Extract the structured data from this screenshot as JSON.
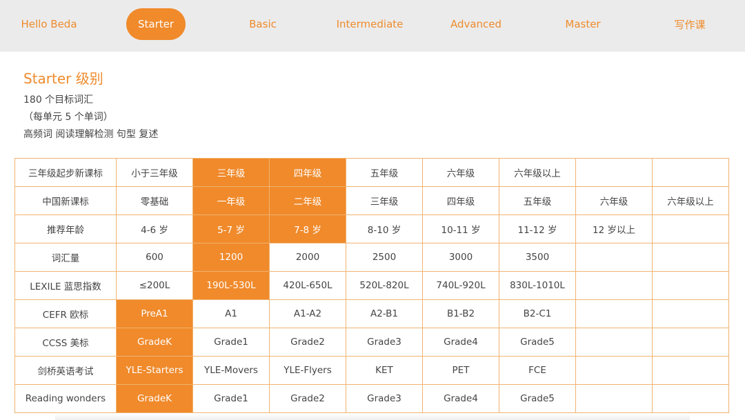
{
  "nav": {
    "items": [
      {
        "label": "Hello Beda"
      },
      {
        "label": "Starter"
      },
      {
        "label": "Basic"
      },
      {
        "label": "Intermediate"
      },
      {
        "label": "Advanced"
      },
      {
        "label": "Master"
      },
      {
        "label": "写作课"
      }
    ],
    "active_index": 1
  },
  "intro": {
    "title": "Starter 级别",
    "lines": [
      "180 个目标词汇",
      "（每单元 5 个单词）",
      "高频词 阅读理解检测 句型 复述"
    ]
  },
  "table": {
    "rows": [
      {
        "cells": [
          "三年级起步新课标",
          "小于三年级",
          "三年级",
          "四年级",
          "五年级",
          "六年级",
          "六年级以上",
          "",
          ""
        ],
        "highlight": [
          2,
          3
        ]
      },
      {
        "cells": [
          "中国新课标",
          "零基础",
          "一年级",
          "二年级",
          "三年级",
          "四年级",
          "五年级",
          "六年级",
          "六年级以上"
        ],
        "highlight": [
          2,
          3
        ]
      },
      {
        "cells": [
          "推荐年龄",
          "4-6 岁",
          "5-7 岁",
          "7-8 岁",
          "8-10 岁",
          "10-11 岁",
          "11-12 岁",
          "12 岁以上",
          ""
        ],
        "highlight": [
          2,
          3
        ]
      },
      {
        "cells": [
          "词汇量",
          "600",
          "1200",
          "2000",
          "2500",
          "3000",
          "3500",
          "",
          ""
        ],
        "highlight": [
          2
        ]
      },
      {
        "cells": [
          "LEXILE 蓝思指数",
          "≤200L",
          "190L-530L",
          "420L-650L",
          "520L-820L",
          "740L-920L",
          "830L-1010L",
          "",
          ""
        ],
        "highlight": [
          2
        ]
      },
      {
        "cells": [
          "CEFR 欧标",
          "PreA1",
          "A1",
          "A1-A2",
          "A2-B1",
          "B1-B2",
          "B2-C1",
          "",
          ""
        ],
        "highlight": [
          1
        ]
      },
      {
        "cells": [
          "CCSS 美标",
          "GradeK",
          "Grade1",
          "Grade2",
          "Grade3",
          "Grade4",
          "Grade5",
          "",
          ""
        ],
        "highlight": [
          1
        ]
      },
      {
        "cells": [
          "剑桥英语考试",
          "YLE-Starters",
          "YLE-Movers",
          "YLE-Flyers",
          "KET",
          "PET",
          "FCE",
          "",
          ""
        ],
        "highlight": [
          1
        ]
      },
      {
        "cells": [
          "Reading wonders",
          "GradeK",
          "Grade1",
          "Grade2",
          "Grade3",
          "Grade4",
          "Grade5",
          "",
          ""
        ],
        "highlight": [
          1
        ]
      }
    ]
  },
  "colors": {
    "accent": "#f08a2b",
    "accent_text": "#ee8b2c",
    "table_border": "#f0b370",
    "nav_background": "#ebebeb",
    "body_text": "#444444"
  }
}
